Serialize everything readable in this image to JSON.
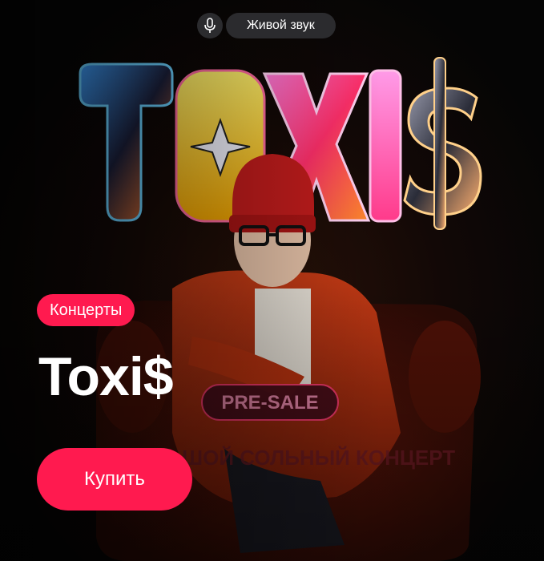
{
  "header": {
    "mic_icon": "microphone-icon",
    "live_label": "Живой звук"
  },
  "poster": {
    "logo_text": "TOXI$",
    "presale_label": "PRE-SALE",
    "subtitle": "БОЛЬШОЙ СОЛЬНЫЙ КОНЦЕРТ"
  },
  "event": {
    "category": "Концерты",
    "title": "Toxi$"
  },
  "actions": {
    "buy_label": "Купить"
  },
  "colors": {
    "accent": "#ff1a4f",
    "pill_bg": "#2b2b2e"
  }
}
